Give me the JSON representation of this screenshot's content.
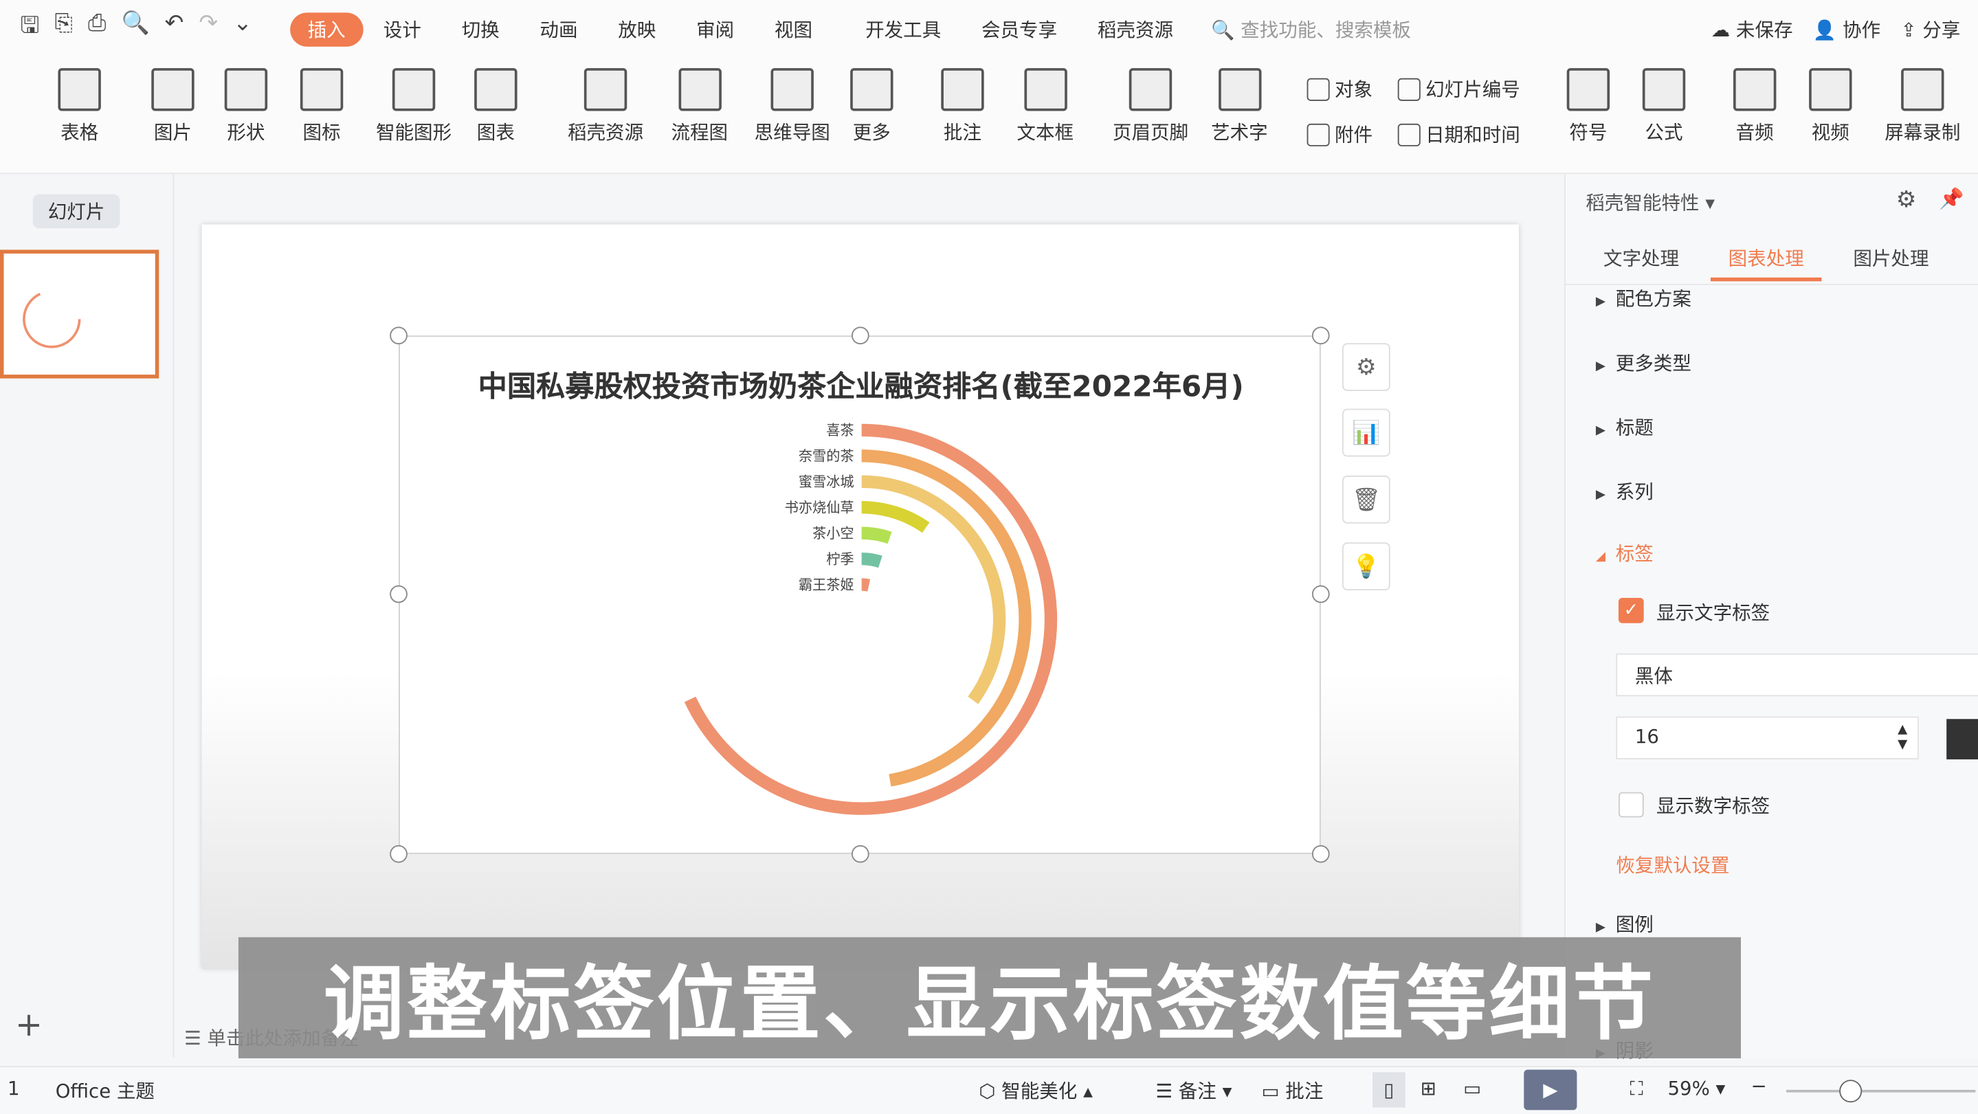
{
  "menubar": {
    "tabs": [
      "插入",
      "设计",
      "切换",
      "动画",
      "放映",
      "审阅",
      "视图",
      "开发工具",
      "会员专享",
      "稻壳资源"
    ],
    "active_tab": "插入",
    "search_placeholder": "查找功能、搜索模板",
    "unsaved": "未保存",
    "collab": "协作",
    "share": "分享"
  },
  "ribbon": {
    "big": [
      "表格",
      "图片",
      "形状",
      "图标",
      "智能图形",
      "图表",
      "稻壳资源",
      "流程图",
      "思维导图",
      "更多",
      "批注",
      "文本框",
      "页眉页脚",
      "艺术字"
    ],
    "small": [
      "对象",
      "幻灯片编号",
      "附件",
      "日期和时间"
    ],
    "big2": [
      "符号",
      "公式",
      "音频",
      "视频",
      "屏幕录制"
    ]
  },
  "leftpane": {
    "tab": "幻灯片",
    "slide_number": "1"
  },
  "chart_data": {
    "type": "radial-bar",
    "title": "中国私募股权投资市场奶茶企业融资排名(截至2022年6月)",
    "categories": [
      "喜茶",
      "奈雪的茶",
      "蜜雪冰城",
      "书亦烧仙草",
      "茶小空",
      "柠季",
      "霸王茶姬"
    ],
    "values": [
      245,
      170,
      126,
      35,
      19,
      18,
      12
    ],
    "angle_max": 360,
    "colors": [
      "#ef9270",
      "#f0a862",
      "#f0c872",
      "#d8d232",
      "#b2e052",
      "#72c2a2",
      "#f09272"
    ]
  },
  "panel": {
    "title": "稻壳智能特性",
    "tabs": [
      "文字处理",
      "图表处理",
      "图片处理"
    ],
    "active_tab": "图表处理",
    "sections": [
      "配色方案",
      "更多类型",
      "标题",
      "系列"
    ],
    "open_section": "标签",
    "show_text_label": "显示文字标签",
    "font": "黑体",
    "font_size": "16",
    "show_number_label": "显示数字标签",
    "reset": "恢复默认设置",
    "more_sections": [
      "图例",
      "阴影"
    ]
  },
  "notes_placeholder": "单击此处添加备注",
  "caption": "调整标签位置、显示标签数值等细节",
  "status": {
    "page": "1",
    "theme": "Office 主题",
    "beautify": "智能美化",
    "notes": "备注",
    "comment": "批注",
    "zoom": "59%"
  },
  "accent": "#f07c4f"
}
